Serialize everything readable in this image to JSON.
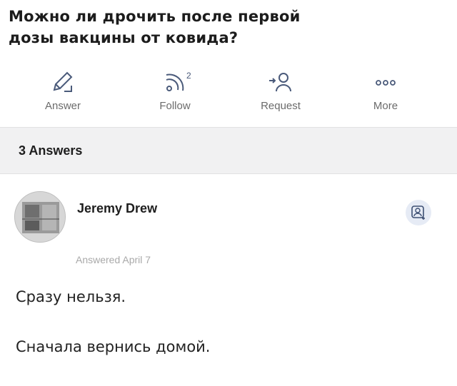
{
  "question": {
    "title_line1": "Можно ли дрочить после первой",
    "title_line2": "дозы вакцины от ковида?"
  },
  "actions": {
    "answer_label": "Answer",
    "follow_label": "Follow",
    "follow_count": "2",
    "request_label": "Request",
    "more_label": "More"
  },
  "answers": {
    "count_label": "3 Answers"
  },
  "answer": {
    "author_name": "Jeremy Drew",
    "answered_date": "Answered April 7",
    "line1": "Сразу нельзя.",
    "line2": "Сначала вернись домой."
  },
  "icons": {
    "answer": "pencil-icon",
    "follow": "follow-signal-icon",
    "request": "add-person-icon",
    "more": "more-dots-icon",
    "follow_user": "add-user-badge-icon"
  },
  "colors": {
    "icon_blue": "#4a5a7a",
    "header_bg": "#f1f1f2",
    "muted_text": "#6b6b6b"
  }
}
